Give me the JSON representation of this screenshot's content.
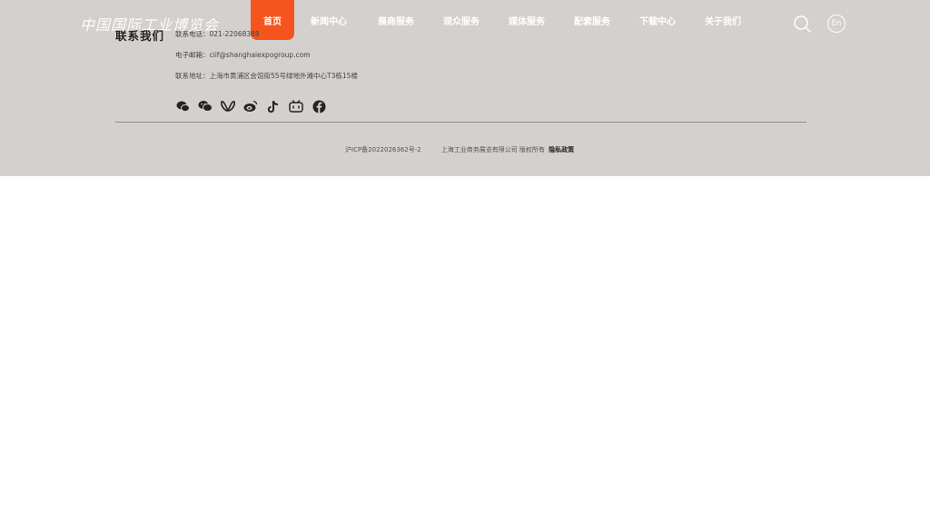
{
  "header": {
    "logo_text": "中国国际工业博览会",
    "nav": [
      {
        "label": "首页",
        "active": true
      },
      {
        "label": "新闻中心"
      },
      {
        "label": "展商服务"
      },
      {
        "label": "观众服务"
      },
      {
        "label": "媒体服务"
      },
      {
        "label": "配套服务"
      },
      {
        "label": "下载中心"
      },
      {
        "label": "关于我们"
      }
    ],
    "lang": "En",
    "search_icon": "search-icon"
  },
  "contact": {
    "title": "联系我们",
    "phone": "联系电话：021-22068388",
    "email": "电子邮箱：ciif@shanghaiexpogroup.com",
    "address": "联系地址：上海市黄浦区会馆街55号绿地外滩中心T3栋15楼"
  },
  "socials": [
    "chat-bubbles-icon",
    "wechat-icon",
    "weixin-channel-icon",
    "weibo-icon",
    "tiktok-icon",
    "bilibili-icon",
    "facebook-icon"
  ],
  "footer": {
    "icp": "沪ICP备2022026362号-2",
    "copyright": "上海工业商务展览有限公司 版权所有",
    "privacy": "隐私政策"
  },
  "colors": {
    "accent": "#f6541f",
    "footer_bg": "#d4d0cd",
    "text_dark": "#222222"
  }
}
